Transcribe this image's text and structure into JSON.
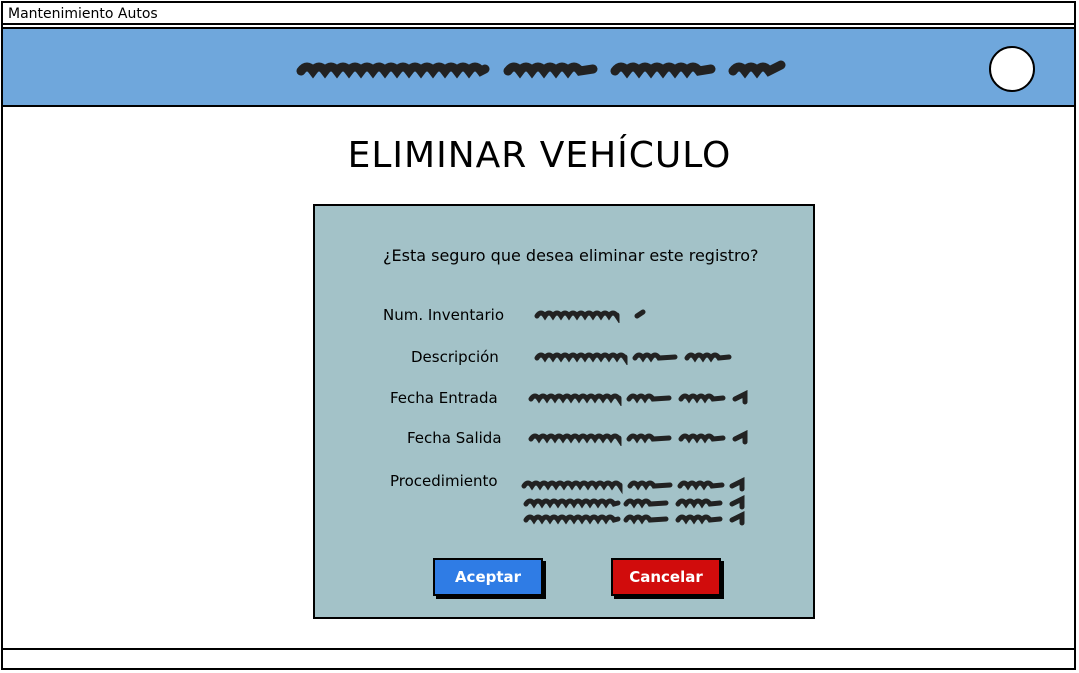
{
  "window": {
    "title": "Mantenimiento Autos"
  },
  "page": {
    "title": "ELIMINAR VEHÍCULO"
  },
  "dialog": {
    "question": "¿Esta seguro que desea eliminar este registro?",
    "fields": {
      "inventario_label": "Num. Inventario",
      "descripcion_label": "Descripción",
      "fecha_entrada_label": "Fecha Entrada",
      "fecha_salida_label": "Fecha Salida",
      "procedimiento_label": "Procedimiento"
    },
    "accept_label": "Aceptar",
    "cancel_label": "Cancelar"
  },
  "colors": {
    "header": "#6fa7dc",
    "panel": "#a3c2c8",
    "accept": "#2f7ce5",
    "cancel": "#d10c0c"
  },
  "icons": {
    "avatar": "user-avatar-icon"
  }
}
